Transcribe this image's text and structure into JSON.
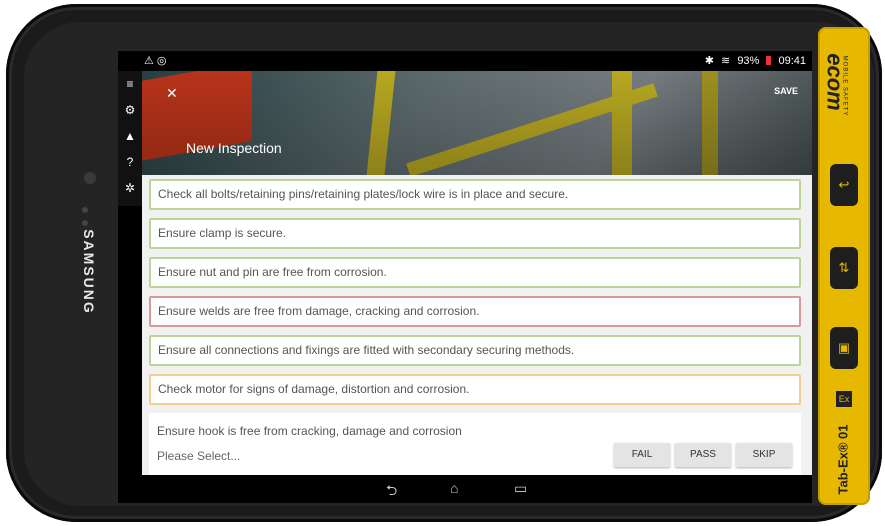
{
  "device": {
    "brand": "SAMSUNG",
    "side_logo": "ecom",
    "side_logo_sub": "MOBILE SAFETY",
    "model": "Tab-Ex® 01"
  },
  "status_bar": {
    "left_icons": "⚠ ◎",
    "bluetooth": "✱",
    "wifi": "≋",
    "battery": "93%",
    "time": "09:41"
  },
  "nav_rail": [
    "≡",
    "⚙",
    "▲",
    "?",
    "✲"
  ],
  "header": {
    "close_label": "✕",
    "save_label": "SAVE",
    "title": "New Inspection"
  },
  "checklist": [
    {
      "text": "Check all bolts/retaining pins/retaining plates/lock wire is in place and secure.",
      "status": "green"
    },
    {
      "text": "Ensure clamp is secure.",
      "status": "green"
    },
    {
      "text": "Ensure nut and pin are free from corrosion.",
      "status": "green"
    },
    {
      "text": "Ensure welds are free from damage, cracking and corrosion.",
      "status": "red"
    },
    {
      "text": "Ensure all connections and fixings are fitted with secondary securing methods.",
      "status": "green"
    },
    {
      "text": "Check motor for signs of damage, distortion and corrosion.",
      "status": "orange"
    }
  ],
  "current_item": {
    "text": "Ensure hook is free from cracking, damage and corrosion",
    "select_placeholder": "Please Select...",
    "fail_label": "FAIL",
    "pass_label": "PASS",
    "skip_label": "SKIP"
  },
  "navbar": {
    "back": "⮌",
    "home": "⌂",
    "recents": "▭"
  },
  "hw_buttons": [
    "↩",
    "⇅",
    "▣"
  ],
  "colors": {
    "green_border": "#bcd39a",
    "red_border": "#d79a9a",
    "orange_border": "#f0cf93",
    "case_yellow": "#e6b800"
  }
}
